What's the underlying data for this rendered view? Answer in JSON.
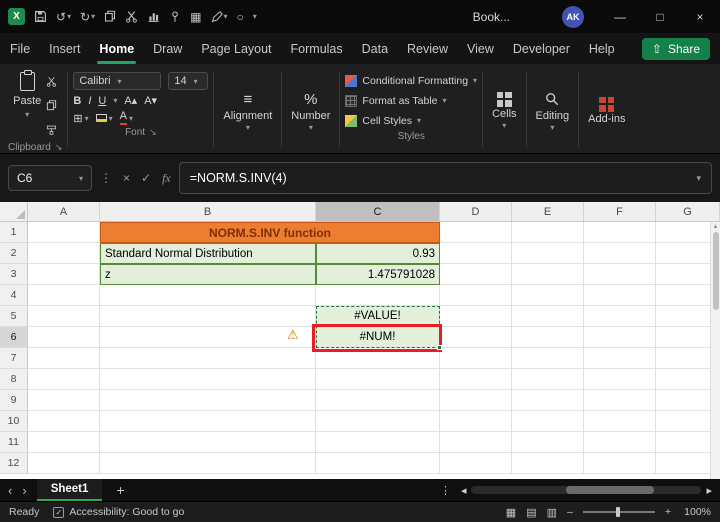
{
  "titlebar": {
    "document_name": "Book...",
    "avatar_initials": "AK"
  },
  "menubar": {
    "tabs": [
      "File",
      "Insert",
      "Home",
      "Draw",
      "Page Layout",
      "Formulas",
      "Data",
      "Review",
      "View",
      "Developer",
      "Help"
    ],
    "active_tab": "Home",
    "share_label": "Share"
  },
  "ribbon": {
    "clipboard": {
      "group_label": "Clipboard",
      "paste_label": "Paste"
    },
    "font": {
      "group_label": "Font",
      "font_name": "Calibri",
      "font_size": "14",
      "bold": "B",
      "italic": "I",
      "underline": "U",
      "grow": "A▴",
      "shrink": "A▾",
      "borders": "⊞",
      "color_letter": "A"
    },
    "alignment": {
      "label": "Alignment"
    },
    "number": {
      "label": "Number"
    },
    "styles": {
      "group_label": "Styles",
      "conditional_formatting": "Conditional Formatting",
      "format_as_table": "Format as Table",
      "cell_styles": "Cell Styles"
    },
    "cells": {
      "label": "Cells"
    },
    "editing": {
      "label": "Editing"
    },
    "addins": {
      "label": "Add-ins"
    }
  },
  "formula_bar": {
    "name_box": "C6",
    "formula": "=NORM.S.INV(4)"
  },
  "grid": {
    "selected_cell": "C6",
    "columns": [
      "A",
      "B",
      "C",
      "D",
      "E",
      "F",
      "G"
    ],
    "rows": [
      "1",
      "2",
      "3",
      "4",
      "5",
      "6",
      "7",
      "8",
      "9",
      "10",
      "11",
      "12"
    ],
    "cells": {
      "title_b1": "NORM.S.INV function",
      "b2": "Standard Normal Distribution",
      "c2": "0.93",
      "b3": "z",
      "c3": "1.475791028",
      "c5": "#VALUE!",
      "c6": "#NUM!"
    }
  },
  "sheet_bar": {
    "active_tab": "Sheet1"
  },
  "status_bar": {
    "mode": "Ready",
    "accessibility": "Accessibility: Good to go",
    "zoom": "100%"
  },
  "colors": {
    "accent_green": "#21A366",
    "header_fill": "#ED7D31",
    "header_text": "#7E2F05",
    "light_green_fill": "#E2EFDA",
    "green_border": "#568A34",
    "marquee_green": "#217346",
    "highlight_red": "#EC1C24"
  },
  "icons": {
    "dropdown": "▾",
    "undo": "↺",
    "redo": "↻",
    "record": "○",
    "table": "▦",
    "minimize": "—",
    "maximize": "□",
    "close_x": "×",
    "check": "✓",
    "cancel": "×",
    "vdots": "⋮",
    "fx": "fx",
    "warning": "⚠",
    "nav_left": "‹",
    "nav_right": "›",
    "tri_up": "▲",
    "tri_left": "◂",
    "tri_right": "▸",
    "plus": "+",
    "minus": "–",
    "share_arrow": "⇧",
    "launcher": "↘",
    "align_lines": "≡",
    "percent": "%",
    "view_normal": "▦",
    "view_layout": "▤",
    "view_break": "▥"
  }
}
